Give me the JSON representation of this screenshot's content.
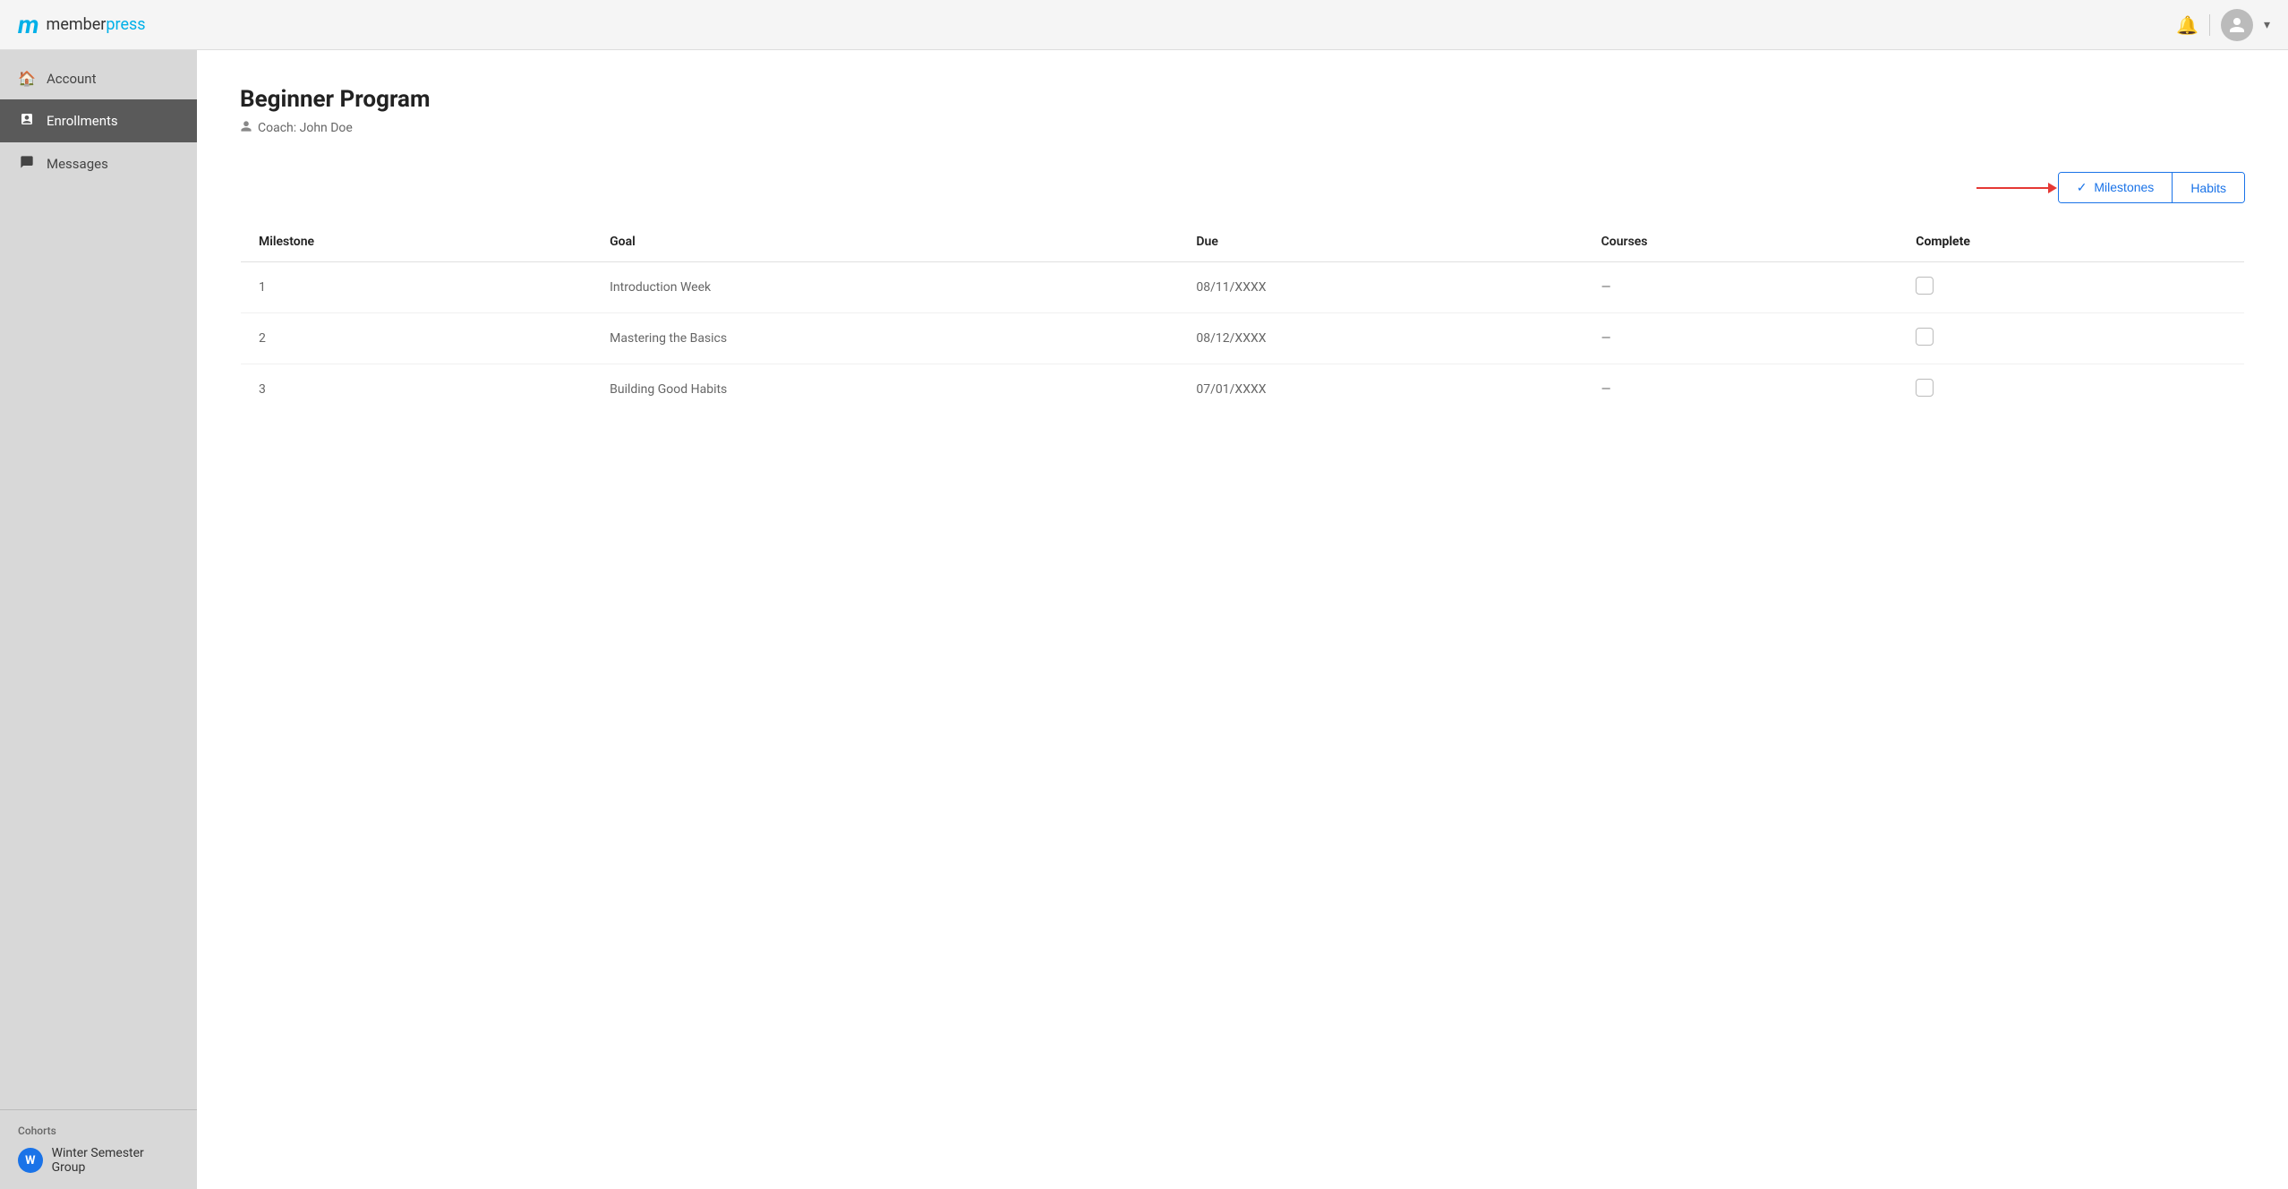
{
  "header": {
    "logo_m": "m",
    "logo_member": "member",
    "logo_press": "press"
  },
  "sidebar": {
    "items": [
      {
        "id": "account",
        "label": "Account",
        "icon": "🏠",
        "active": false
      },
      {
        "id": "enrollments",
        "label": "Enrollments",
        "icon": "📋",
        "active": true
      },
      {
        "id": "messages",
        "label": "Messages",
        "icon": "💬",
        "active": false
      }
    ],
    "cohorts_label": "Cohorts",
    "cohort": {
      "initial": "W",
      "name": "Winter Semester Group"
    }
  },
  "main": {
    "program_title": "Beginner Program",
    "coach_label": "Coach: John Doe",
    "tabs": [
      {
        "id": "milestones",
        "label": "Milestones",
        "active": true,
        "check": "✓"
      },
      {
        "id": "habits",
        "label": "Habits",
        "active": false
      }
    ],
    "table": {
      "headers": [
        "Milestone",
        "Goal",
        "Due",
        "Courses",
        "Complete"
      ],
      "rows": [
        {
          "milestone": "1",
          "goal": "Introduction Week",
          "due": "08/11/XXXX",
          "courses": "—",
          "complete": false
        },
        {
          "milestone": "2",
          "goal": "Mastering the Basics",
          "due": "08/12/XXXX",
          "courses": "—",
          "complete": false
        },
        {
          "milestone": "3",
          "goal": "Building Good Habits",
          "due": "07/01/XXXX",
          "courses": "—",
          "complete": false
        }
      ]
    }
  }
}
